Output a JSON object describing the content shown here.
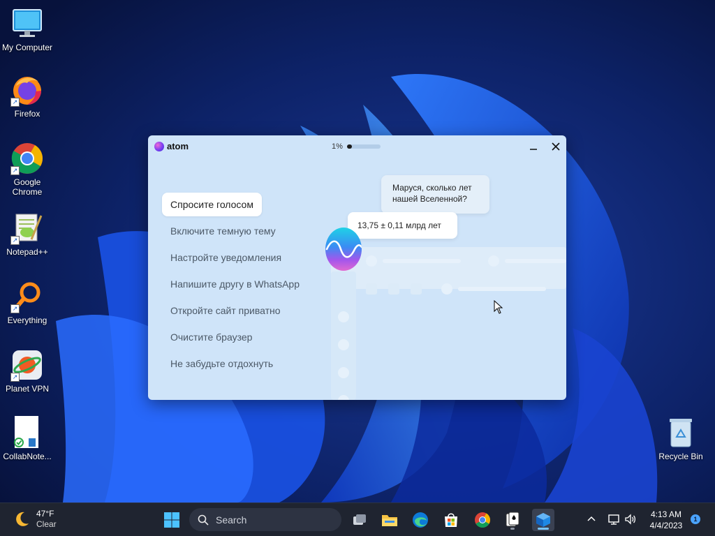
{
  "desktop": {
    "icons": [
      {
        "label": "My Computer",
        "icon": "monitor-icon"
      },
      {
        "label": "Firefox",
        "icon": "firefox-icon"
      },
      {
        "label": "Google Chrome",
        "icon": "chrome-icon"
      },
      {
        "label": "Notepad++",
        "icon": "notepadpp-icon"
      },
      {
        "label": "Everything",
        "icon": "everything-icon"
      },
      {
        "label": "Planet VPN",
        "icon": "planet-vpn-icon"
      },
      {
        "label": "CollabNote...",
        "icon": "collabnote-icon"
      },
      {
        "label": "Recycle Bin",
        "icon": "recycle-bin-icon"
      }
    ]
  },
  "atom": {
    "brand": "atom",
    "progress_text": "1%",
    "progress_value": 0.01,
    "menu": [
      {
        "label": "Спросите голосом",
        "active": true
      },
      {
        "label": "Включите темную тему"
      },
      {
        "label": "Настройте уведомления"
      },
      {
        "label": "Напишите другу в WhatsApp"
      },
      {
        "label": "Откройте сайт приватно"
      },
      {
        "label": "Очистите браузер"
      },
      {
        "label": "Не забудьте отдохнуть"
      }
    ],
    "question": "Маруся, сколько лет нашей Вселенной?",
    "answer": "13,75 ± 0,11 млрд лет"
  },
  "taskbar": {
    "weather": {
      "temp": "47°F",
      "condition": "Clear"
    },
    "search_label": "Search",
    "time": "4:13 AM",
    "date": "4/4/2023",
    "notification_count": "1"
  },
  "colors": {
    "accent": "#78c4ff",
    "window_bg": "#cfe4f9",
    "taskbar_bg": "#1f2430"
  }
}
